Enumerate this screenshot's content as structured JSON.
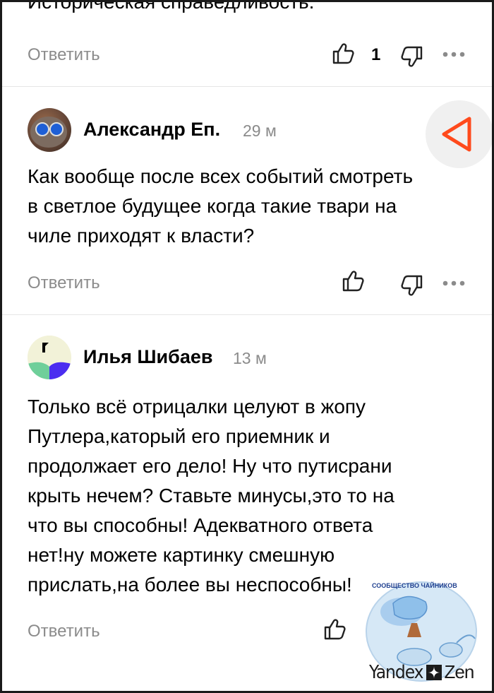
{
  "comments": [
    {
      "text_partial": "Историческая справедливость.",
      "reply": "Ответить",
      "likes": "1"
    },
    {
      "author": "Александр Еп.",
      "time": "29 м",
      "lines": [
        "Как вообще после всех событий смотреть",
        "в светлое будущее когда такие твари на",
        "чиле приходят к власти?"
      ],
      "reply": "Ответить"
    },
    {
      "author": "Илья Шибаев",
      "time": "13 м",
      "lines": [
        "Только всё отрицалки целуют в жопу",
        "Путлера,каторый его приемник и",
        "продолжает его дело! Ну что путисрани",
        "крыть нечем? Ставьте минусы,это то на",
        "что вы способны! Адекватного ответа",
        "нет!ну можете картинку смешную",
        "прислать,на более вы неспособны!"
      ],
      "reply": "Ответить"
    }
  ],
  "watermark": {
    "top_text": "СООБЩЕСТВО ЧАЙНИКОВ",
    "brand_left": "Yandex",
    "brand_right": "Zen"
  },
  "colors": {
    "accent": "#ff4a1c",
    "muted": "#8b8b8b"
  },
  "icons": [
    "like-icon",
    "dislike-icon",
    "more-icon",
    "back-triangle-icon"
  ]
}
